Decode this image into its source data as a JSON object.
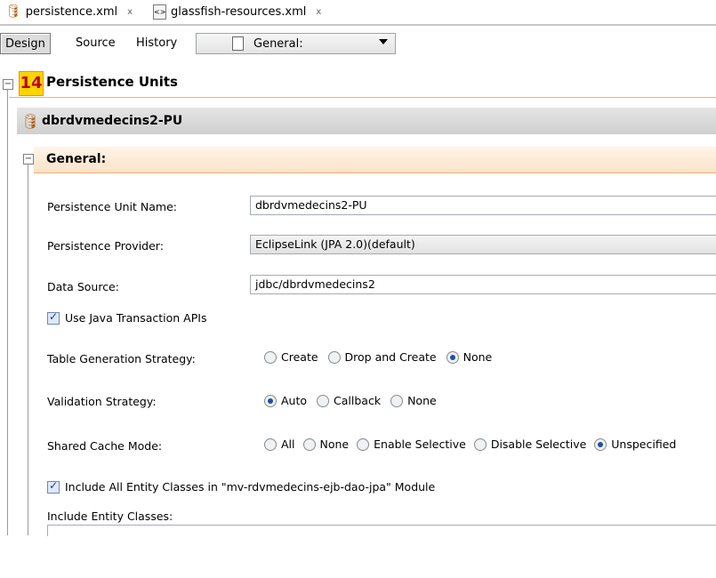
{
  "tabs": [
    {
      "label": "persistence.xml",
      "close": "x",
      "icon": "persistence-file-icon"
    },
    {
      "label": "glassfish-resources.xml",
      "close": "x",
      "icon": "xml-file-icon"
    }
  ],
  "toolbar": {
    "design": "Design",
    "source": "Source",
    "history": "History",
    "section_combo": "General:"
  },
  "section": {
    "badge": "14",
    "title": "Persistence Units",
    "unit_name_header": "dbrdvmedecins2-PU",
    "general_header": "General:"
  },
  "form": {
    "unit_name_label": "Persistence Unit Name:",
    "unit_name_value": "dbrdvmedecins2-PU",
    "provider_label": "Persistence Provider:",
    "provider_value": "EclipseLink (JPA 2.0)(default)",
    "datasource_label": "Data Source:",
    "datasource_value": "jdbc/dbrdvmedecins2",
    "jta_label": "Use Java Transaction APIs",
    "jta_checked": true,
    "table_gen_label": "Table Generation Strategy:",
    "table_gen_options": [
      "Create",
      "Drop and Create",
      "None"
    ],
    "table_gen_selected": "None",
    "validation_label": "Validation Strategy:",
    "validation_options": [
      "Auto",
      "Callback",
      "None"
    ],
    "validation_selected": "Auto",
    "cache_label": "Shared Cache Mode:",
    "cache_options": [
      "All",
      "None",
      "Enable Selective",
      "Disable Selective",
      "Unspecified"
    ],
    "cache_selected": "Unspecified",
    "include_all_label": "Include All Entity Classes in \"mv-rdvmedecins-ejb-dao-jpa\" Module",
    "include_all_checked": true,
    "entity_classes_label": "Include Entity Classes:"
  }
}
